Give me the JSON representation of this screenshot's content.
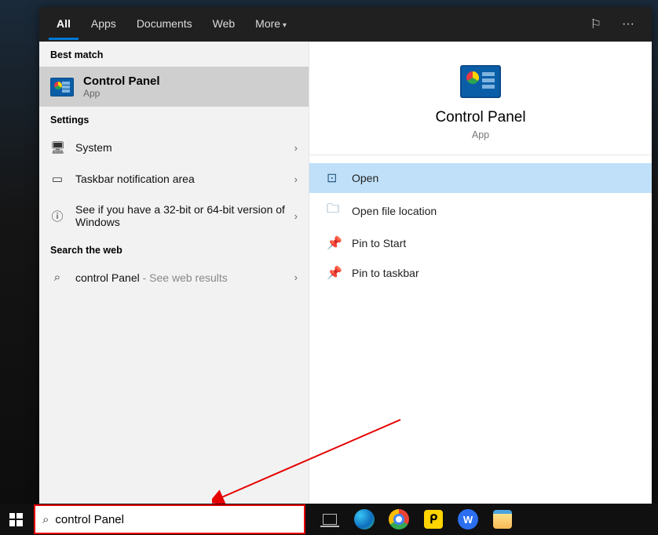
{
  "tabs": {
    "all": "All",
    "apps": "Apps",
    "documents": "Documents",
    "web": "Web",
    "more": "More"
  },
  "sections": {
    "best": "Best match",
    "settings": "Settings",
    "web": "Search the web"
  },
  "bestMatch": {
    "title": "Control Panel",
    "subtitle": "App"
  },
  "settingsItems": [
    {
      "icon": "🖥",
      "label": "System"
    },
    {
      "icon": "▭",
      "label": "Taskbar notification area"
    },
    {
      "icon": "ⓘ",
      "label": "See if you have a 32-bit or 64-bit version of Windows"
    }
  ],
  "webItem": {
    "query": "control Panel",
    "suffix": " - See web results"
  },
  "preview": {
    "title": "Control Panel",
    "subtitle": "App"
  },
  "actions": [
    {
      "icon": "⊡",
      "label": "Open",
      "selected": true
    },
    {
      "icon": "🗀",
      "label": "Open file location",
      "selected": false
    },
    {
      "icon": "📌",
      "label": "Pin to Start",
      "selected": false
    },
    {
      "icon": "📌",
      "label": "Pin to taskbar",
      "selected": false
    }
  ],
  "search": {
    "value": "control Panel"
  }
}
